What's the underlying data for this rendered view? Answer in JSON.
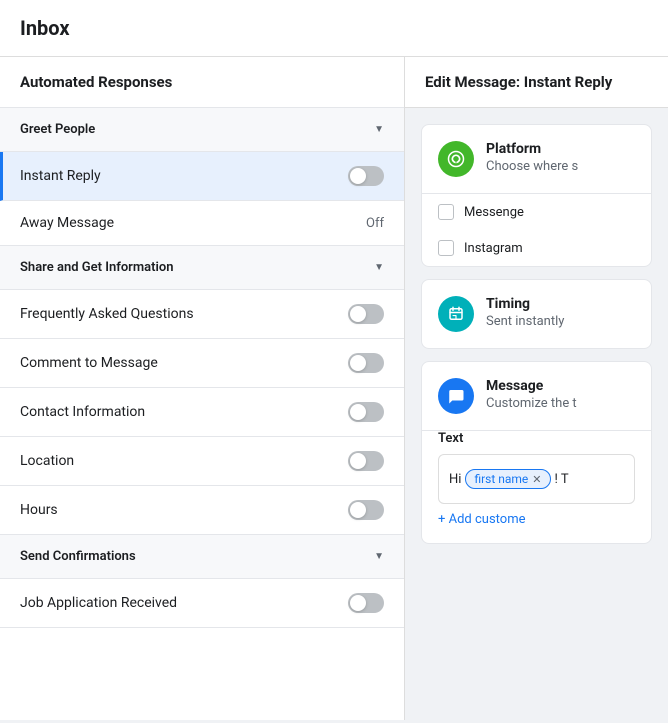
{
  "header": {
    "title": "Inbox"
  },
  "left_panel": {
    "title": "Automated Responses",
    "sections": [
      {
        "id": "greet-people",
        "label": "Greet People",
        "items": [
          {
            "id": "instant-reply",
            "label": "Instant Reply",
            "toggle": true,
            "active": true,
            "toggled": false
          },
          {
            "id": "away-message",
            "label": "Away Message",
            "status": "Off"
          }
        ]
      },
      {
        "id": "share-get-info",
        "label": "Share and Get Information",
        "items": [
          {
            "id": "faq",
            "label": "Frequently Asked Questions",
            "toggle": true,
            "toggled": false
          },
          {
            "id": "comment-message",
            "label": "Comment to Message",
            "toggle": true,
            "toggled": false
          },
          {
            "id": "contact-info",
            "label": "Contact Information",
            "toggle": true,
            "toggled": false
          },
          {
            "id": "location",
            "label": "Location",
            "toggle": true,
            "toggled": false
          },
          {
            "id": "hours",
            "label": "Hours",
            "toggle": true,
            "toggled": false
          }
        ]
      },
      {
        "id": "send-confirmations",
        "label": "Send Confirmations",
        "items": [
          {
            "id": "job-application",
            "label": "Job Application Received",
            "toggle": true,
            "toggled": false
          }
        ]
      }
    ]
  },
  "right_panel": {
    "header": "Edit Message: Instant Reply",
    "cards": [
      {
        "id": "platform",
        "icon_type": "green",
        "icon_symbol": "⊕",
        "title": "Platform",
        "subtitle": "Choose where s",
        "checkboxes": [
          {
            "label": "Messenge"
          },
          {
            "label": "Instagram"
          }
        ]
      },
      {
        "id": "timing",
        "icon_type": "teal",
        "icon_symbol": "⏱",
        "title": "Timing",
        "subtitle": "Sent instantly"
      },
      {
        "id": "message",
        "icon_type": "blue",
        "icon_symbol": "💬",
        "title": "Message",
        "subtitle": "Customize the t",
        "text_label": "Text",
        "input_prefix": "Hi",
        "tag": "first name",
        "input_suffix": "! T",
        "add_link": "+ Add custome"
      }
    ]
  }
}
